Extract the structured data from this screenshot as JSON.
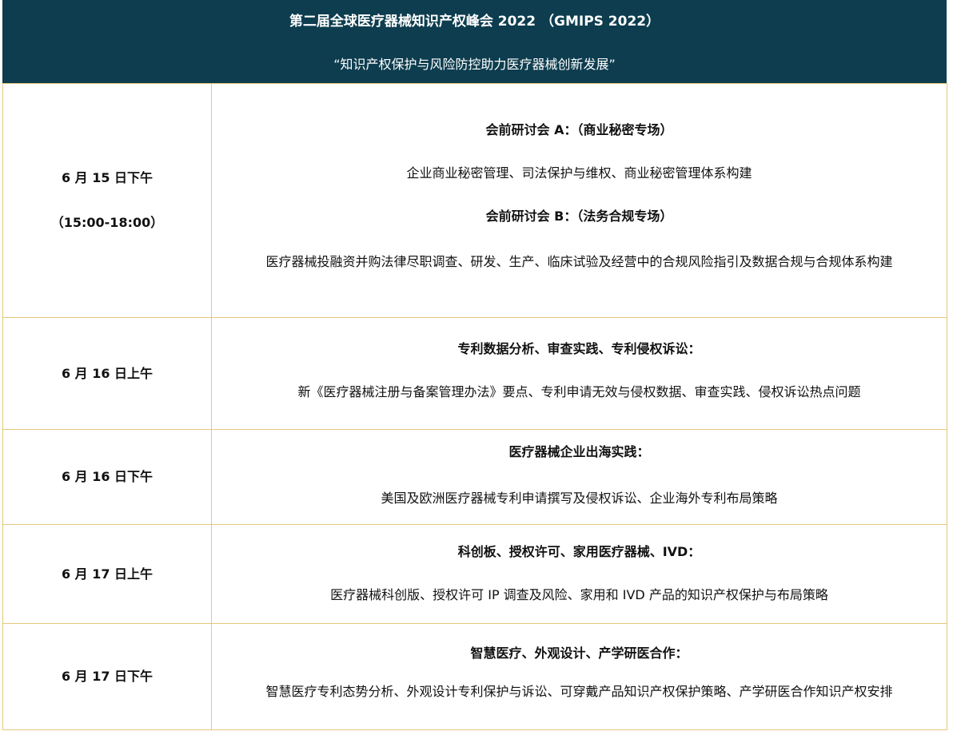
{
  "header": {
    "title": "第二届全球医疗器械知识产权峰会 2022 （GMIPS 2022）",
    "subtitle": "“知识产权保护与风险防控助力医疗器械创新发展”"
  },
  "colors": {
    "header_background": "#0d3d4f",
    "header_text": "#ffffff",
    "border": "#e6c77b"
  },
  "rows": [
    {
      "date": "6 月 15 日下午",
      "time": "（15:00-18:00）",
      "topic_a": "会前研讨会 A：（商业秘密专场）",
      "desc_a": "企业商业秘密管理、司法保护与维权、商业秘密管理体系构建",
      "topic_b": "会前研讨会 B：（法务合规专场）",
      "desc_b": "医疗器械投融资并购法律尽职调查、研发、生产、临床试验及经营中的合规风险指引及数据合规与合规体系构建"
    },
    {
      "date": "6 月 16 日上午",
      "topic": "专利数据分析、审查实践、专利侵权诉讼：",
      "desc": "新《医疗器械注册与备案管理办法》要点、专利申请无效与侵权数据、审查实践、侵权诉讼热点问题"
    },
    {
      "date": "6 月 16 日下午",
      "topic": "医疗器械企业出海实践：",
      "desc": "美国及欧洲医疗器械专利申请撰写及侵权诉讼、企业海外专利布局策略"
    },
    {
      "date": "6 月 17 日上午",
      "topic": "科创板、授权许可、家用医疗器械、IVD：",
      "desc": "医疗器械科创版、授权许可 IP 调查及风险、家用和 IVD  产品的知识产权保护与布局策略"
    },
    {
      "date": "6 月 17 日下午",
      "topic": "智慧医疗、外观设计、产学研医合作：",
      "desc": "智慧医疗专利态势分析、外观设计专利保护与诉讼、可穿戴产品知识产权保护策略、产学研医合作知识产权安排"
    }
  ]
}
